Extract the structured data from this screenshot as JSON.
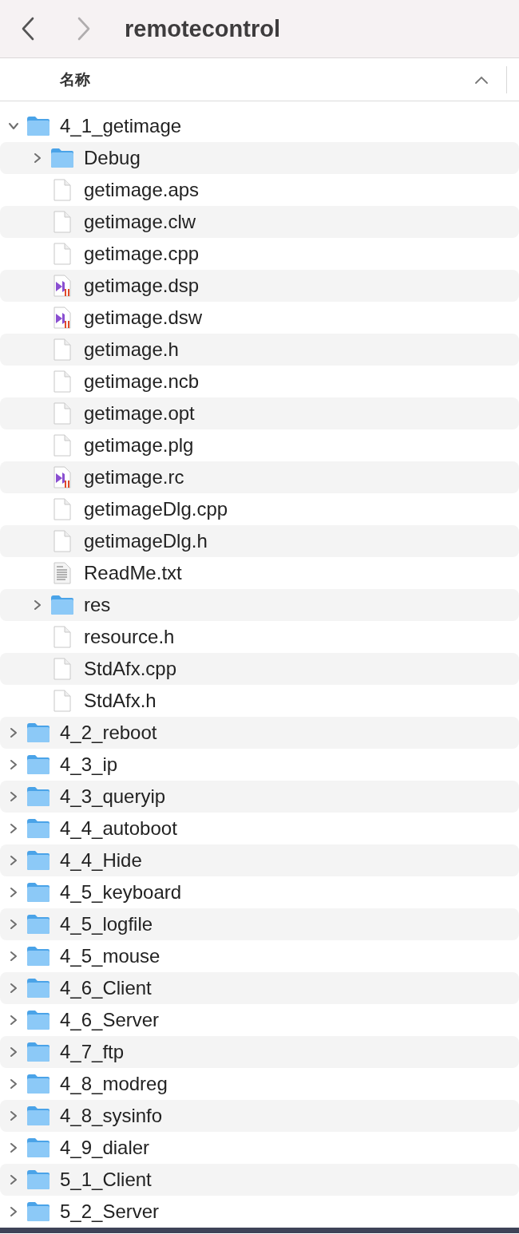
{
  "window": {
    "title": "remotecontrol"
  },
  "column_header": {
    "label": "名称"
  },
  "tree": [
    {
      "name": "4_1_getimage",
      "kind": "folder",
      "expanded": true,
      "children": [
        {
          "name": "Debug",
          "kind": "folder",
          "expanded": false
        },
        {
          "name": "getimage.aps",
          "kind": "file"
        },
        {
          "name": "getimage.clw",
          "kind": "file"
        },
        {
          "name": "getimage.cpp",
          "kind": "file"
        },
        {
          "name": "getimage.dsp",
          "kind": "vs"
        },
        {
          "name": "getimage.dsw",
          "kind": "vs"
        },
        {
          "name": "getimage.h",
          "kind": "file"
        },
        {
          "name": "getimage.ncb",
          "kind": "file"
        },
        {
          "name": "getimage.opt",
          "kind": "file"
        },
        {
          "name": "getimage.plg",
          "kind": "file"
        },
        {
          "name": "getimage.rc",
          "kind": "vs"
        },
        {
          "name": "getimageDlg.cpp",
          "kind": "file"
        },
        {
          "name": "getimageDlg.h",
          "kind": "file"
        },
        {
          "name": "ReadMe.txt",
          "kind": "text"
        },
        {
          "name": "res",
          "kind": "folder",
          "expanded": false
        },
        {
          "name": "resource.h",
          "kind": "file"
        },
        {
          "name": "StdAfx.cpp",
          "kind": "file"
        },
        {
          "name": "StdAfx.h",
          "kind": "file"
        }
      ]
    },
    {
      "name": "4_2_reboot",
      "kind": "folder",
      "expanded": false
    },
    {
      "name": "4_3_ip",
      "kind": "folder",
      "expanded": false
    },
    {
      "name": "4_3_queryip",
      "kind": "folder",
      "expanded": false
    },
    {
      "name": "4_4_autoboot",
      "kind": "folder",
      "expanded": false
    },
    {
      "name": "4_4_Hide",
      "kind": "folder",
      "expanded": false
    },
    {
      "name": "4_5_keyboard",
      "kind": "folder",
      "expanded": false
    },
    {
      "name": "4_5_logfile",
      "kind": "folder",
      "expanded": false
    },
    {
      "name": "4_5_mouse",
      "kind": "folder",
      "expanded": false
    },
    {
      "name": "4_6_Client",
      "kind": "folder",
      "expanded": false
    },
    {
      "name": "4_6_Server",
      "kind": "folder",
      "expanded": false
    },
    {
      "name": "4_7_ftp",
      "kind": "folder",
      "expanded": false
    },
    {
      "name": "4_8_modreg",
      "kind": "folder",
      "expanded": false
    },
    {
      "name": "4_8_sysinfo",
      "kind": "folder",
      "expanded": false
    },
    {
      "name": "4_9_dialer",
      "kind": "folder",
      "expanded": false
    },
    {
      "name": "5_1_Client",
      "kind": "folder",
      "expanded": false
    },
    {
      "name": "5_2_Server",
      "kind": "folder",
      "expanded": false
    }
  ]
}
